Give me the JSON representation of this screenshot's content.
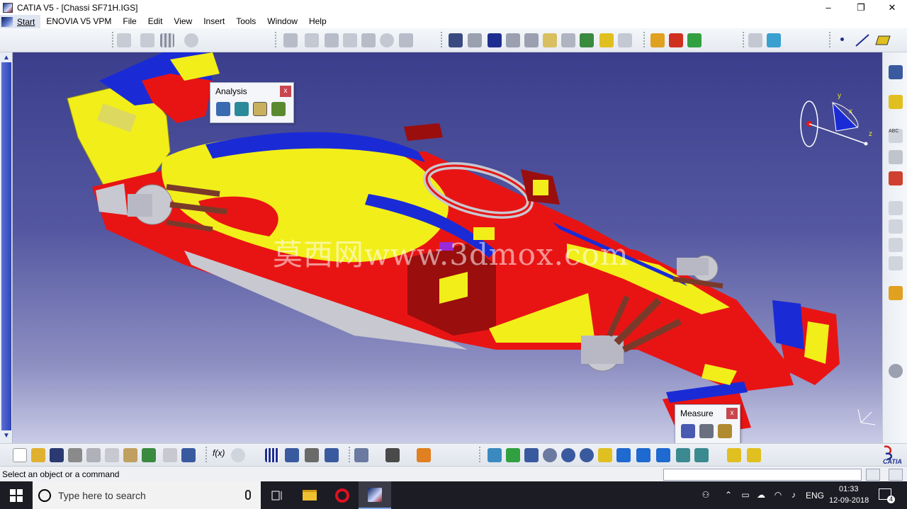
{
  "window": {
    "title": "CATIA V5 - [Chassi SF71H.IGS]",
    "controls": [
      "–",
      "❐",
      "✕"
    ]
  },
  "menu": {
    "start": "Start",
    "items": [
      "ENOVIA V5 VPM",
      "File",
      "Edit",
      "View",
      "Insert",
      "Tools",
      "Window",
      "Help"
    ]
  },
  "viewport": {
    "watermark": "莫西网www.3dmox.com",
    "compass_axes": {
      "x": "x",
      "y": "y",
      "z": "z"
    }
  },
  "panels": {
    "analysis": {
      "title": "Analysis",
      "close": "x"
    },
    "measure": {
      "title": "Measure",
      "close": "x"
    }
  },
  "status": {
    "message": "Select an object or a command"
  },
  "taskbar": {
    "search_placeholder": "Type here to search",
    "language": "ENG",
    "time": "01:33",
    "date": "12-09-2018",
    "notifications": "4"
  },
  "brand": {
    "logo_text": "CATIA"
  },
  "colors": {
    "viewport_top": "#3b3e8c",
    "model_red": "#e81414",
    "model_yellow": "#f2ee1a",
    "model_blue": "#1a2bd6",
    "model_grey": "#c8c8d0",
    "model_darkred": "#9a0e0e"
  }
}
